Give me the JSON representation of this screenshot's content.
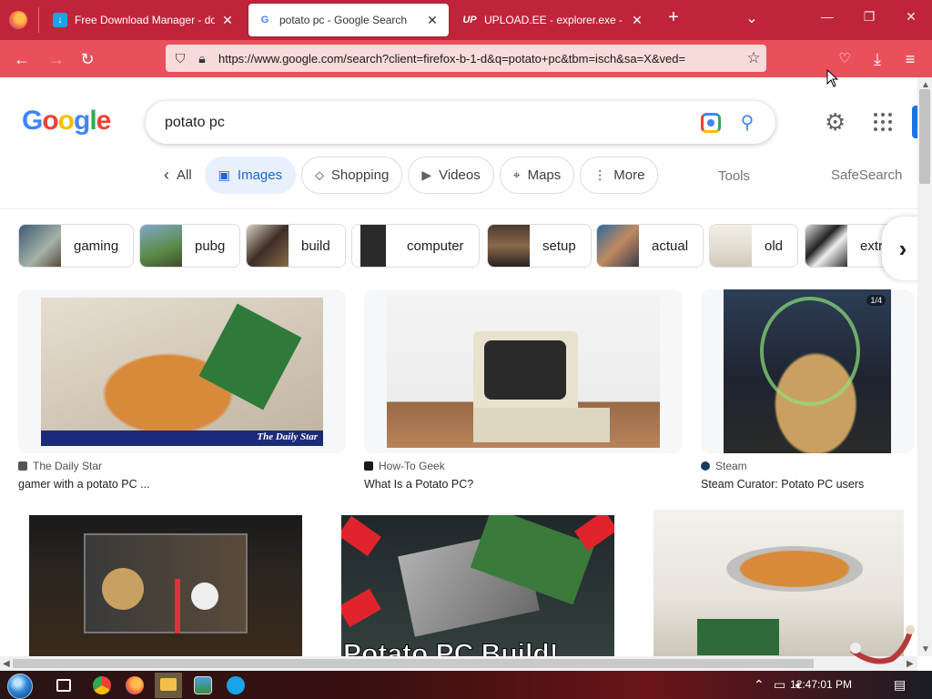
{
  "browser": {
    "tabs": [
      {
        "title": "Free Download Manager - dow",
        "active": false
      },
      {
        "title": "potato pc - Google Search",
        "active": true
      },
      {
        "title": "UPLOAD.EE - explorer.exe - Do",
        "active": false
      }
    ],
    "url": "https://www.google.com/search?client=firefox-b-1-d&q=potato+pc&tbm=isch&sa=X&ved=",
    "tab_bar_color": "#c0243a",
    "nav_bar_color": "#e9505c"
  },
  "google": {
    "logo_letters": [
      "G",
      "o",
      "o",
      "g",
      "l",
      "e"
    ],
    "query": "potato pc",
    "filters": [
      {
        "label": "All",
        "icon": "chevron-left-icon"
      },
      {
        "label": "Images",
        "icon": "image-icon",
        "active": true
      },
      {
        "label": "Shopping",
        "icon": "tag-icon"
      },
      {
        "label": "Videos",
        "icon": "play-icon"
      },
      {
        "label": "Maps",
        "icon": "pin-icon"
      },
      {
        "label": "More",
        "icon": "more-dots-icon"
      }
    ],
    "tools": "Tools",
    "safesearch": "SafeSearch",
    "related": [
      "gaming",
      "pubg",
      "build",
      "computer",
      "setup",
      "actual",
      "old",
      "extre"
    ]
  },
  "results": [
    {
      "source": "The Daily Star",
      "caption": "gamer with a potato PC ...",
      "watermark": "The Daily Star"
    },
    {
      "source": "How-To Geek",
      "caption": "What Is a Potato PC?"
    },
    {
      "source": "Steam",
      "caption": "Steam Curator: Potato PC users",
      "badge": "1/4"
    },
    {
      "source": "",
      "caption": ""
    },
    {
      "source": "",
      "caption": "",
      "overlay_text": "Potato PC Build!"
    },
    {
      "source": "",
      "caption": ""
    }
  ],
  "taskbar": {
    "clock": "12:47:01 PM"
  }
}
